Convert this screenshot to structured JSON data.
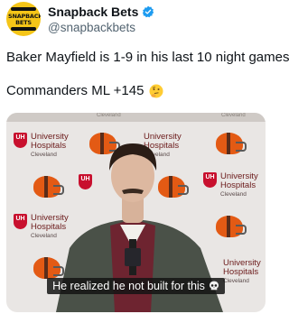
{
  "author": {
    "display_name": "Snapback Bets",
    "handle": "@snapbackbets",
    "avatar_text": "SNAPBACK BETS"
  },
  "tweet": {
    "line1": "Baker Mayfield is 1-9 in his last 10 night games.",
    "line2": "Commanders ML +145",
    "line2_emoji": "thinking-face-emoji"
  },
  "media": {
    "caption": "He realized he not built for this",
    "caption_emoji": "skull-emoji",
    "backdrop": {
      "wall_label": "Cleveland",
      "logo_title_1": "University",
      "logo_title_2": "Hospitals",
      "logo_sub": "Cleveland",
      "logo_badge": "UH"
    }
  },
  "colors": {
    "avatar_bg": "#f5c518",
    "verified": "#1d9bf0",
    "text": "#0f1419",
    "secondary_text": "#536471",
    "uh_red": "#c8102e",
    "browns_orange": "#e35a14"
  }
}
